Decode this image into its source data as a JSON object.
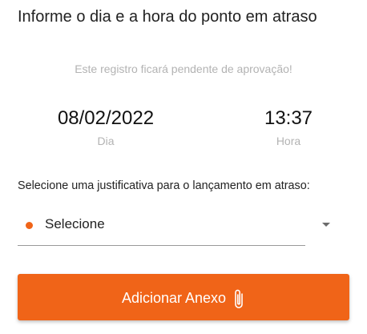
{
  "header": {
    "title": "Informe o dia e a hora do ponto em atraso",
    "subtitle": "Este registro ficará pendente de aprovação!"
  },
  "date": {
    "value": "08/02/2022",
    "label": "Dia"
  },
  "time": {
    "value": "13:37",
    "label": "Hora"
  },
  "justification": {
    "label": "Selecione uma justificativa para o lançamento em atraso:",
    "selected": "Selecione",
    "indicator_icon": "dot-icon",
    "dropdown_icon": "caret-down-icon",
    "indicator_color": "#f06418"
  },
  "attach_button": {
    "label": "Adicionar Anexo",
    "icon": "paperclip-icon",
    "color": "#f06418"
  }
}
